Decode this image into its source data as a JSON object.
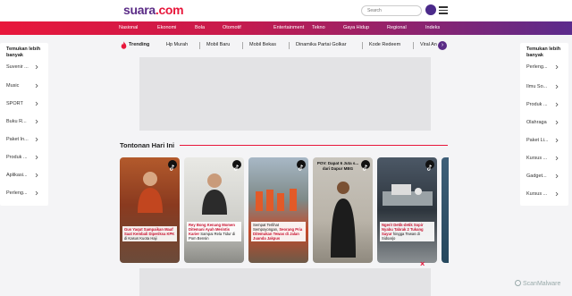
{
  "header": {
    "logo_main": "suara",
    "logo_suffix": ".com",
    "search_placeholder": "Search"
  },
  "categories": [
    "Nasional",
    "Ekonomi",
    "Bola",
    "Otomotif",
    "Entertainment",
    "Tekno",
    "Gaya Hidup",
    "Regional",
    "Indeks"
  ],
  "trending": {
    "label": "Trending",
    "items": [
      "Hp Murah",
      "Mobil Baru",
      "Mobil Bekas",
      "Dinamika Partai Golkar",
      "Kode Redeem",
      "Viral An"
    ]
  },
  "left_panel": {
    "title": "Temukan lebih banyak",
    "items": [
      "Suvenir ...",
      "Music",
      "SPORT",
      "Buku R...",
      "Paket In...",
      "Produk ...",
      "Aplikasi...",
      "Perleng..."
    ]
  },
  "right_panel": {
    "title": "Temukan lebih banyak",
    "items": [
      "Perleng...",
      "Ilmu So...",
      "Produk ...",
      "Olahraga",
      "Paket Li...",
      "Kursus ...",
      "Gadget...",
      "Kursus ..."
    ]
  },
  "section": {
    "title": "Tontonan Hari Ini"
  },
  "videos": [
    {
      "caption_a": "Gus Yaqut Sampaikan Maaf Saat Kembali Diperiksa KPK",
      "caption_b": " di Kasus Kuota Haji",
      "overlay": ""
    },
    {
      "caption_a": "Rey Bong Kenang Momen Ditemani Ayah Merintis Karier",
      "caption_b": " Sampai Rela Tidur di Pom Bensin",
      "overlay": ""
    },
    {
      "caption_a": "Sempat Terlihat Sempoyongan, ",
      "caption_b": "Seorang Pria Ditemukan Tewas di Jalan Juanda Jakpus",
      "overlay": ""
    },
    {
      "caption_a": "",
      "caption_b": "",
      "overlay": "POV: Dapat 6 Juta s... dari Dapur MBG"
    },
    {
      "caption_a": "Ngeri! Detik-detik Sopir Nyabu Tabrak 2 Tukang Sayur",
      "caption_b": " hingga Tewas di Sidoarjo",
      "overlay": ""
    }
  ],
  "close_ad": "×",
  "watermark": "ScanMalware"
}
